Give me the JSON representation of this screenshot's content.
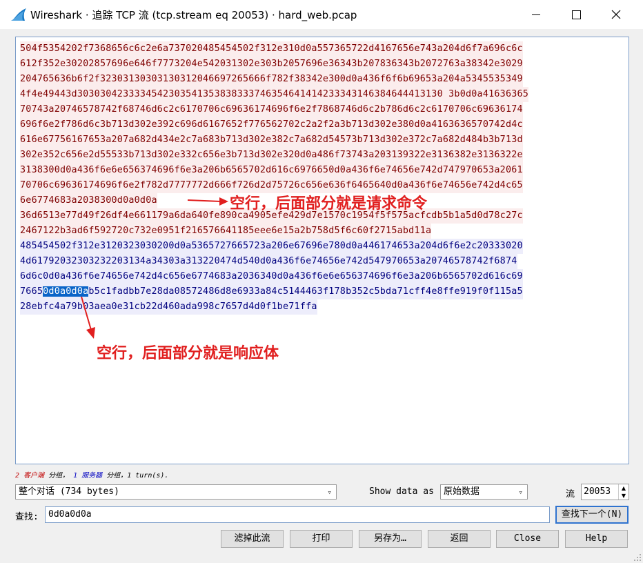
{
  "window": {
    "title": "Wireshark · 追踪 TCP 流 (tcp.stream eq 20053) · hard_web.pcap"
  },
  "stream": {
    "request_lines": [
      "504f5354202f7368656c6c2e6a737020485454502f312e310d0a557365722d4167656e743a204d6f7a696c6c",
      "612f352e30202857696e646f7773204e542031302e303b2057696e36343b207836343b2072763a38342e3029",
      "204765636b6f2f32303130303130312046697265666f782f38342e300d0a436f6f6b69653a204a5345535349",
      "4f4e49443d3030304233334542303541353838333746354641414233343146384644413130 3b0d0a41636365",
      "70743a20746578742f68746d6c2c6170706c69636174696f6e2f7868746d6c2b786d6c2c6170706c69636174",
      "696f6e2f786d6c3b713d302e392c696d6167652f776562702c2a2f2a3b713d302e380d0a4163636570742d4c",
      "616e67756167653a207a682d434e2c7a683b713d302e382c7a682d54573b713d302e372c7a682d484b3b713d",
      "302e352c656e2d55533b713d302e332c656e3b713d302e320d0a486f73743a203139322e3136382e3136322e",
      "3138300d0a436f6e6e656374696f6e3a206b6565702d616c6976650d0a436f6e74656e742d747970653a2061",
      "70706c69636174696f6e2f782d7777772d666f726d2d75726c656e636f6465640d0a436f6e74656e742d4c65",
      "6e6774683a2038300d0a0d0a",
      "36d6513e77d49f26df4e661179a6da640fe890ca4905efe429d7e1570c1954f5f575acfcdb5b1a5d0d78c27c",
      "2467122b3ad6f592720c732e0951f216576641185eee6e15a2b758d5f6c60f2715abd11a"
    ],
    "response_lines": [
      "485454502f312e3120323030200d0a5365727665723a206e67696e780d0a446174653a204d6f6e2c20333020",
      "4d61792032303232203134a34303a313220474d540d0a436f6e74656e742d547970653a20746578742f6874",
      "6d6c0d0a436f6e74656e742d4c656e6774683a2036340d0a436f6e6e656374696f6e3a206b6565702d616c69",
      "7665",
      "0d0a0d0a",
      "b5c1fadbb7e28da08572486d8e6933a84c5144463f178b352c5bda71cff4e8ffe919f0f115a5",
      "28ebfc4a79b03aea0e31cb22d460ada998c7657d4d0f1be71ffa"
    ]
  },
  "annotations": {
    "request_note": "空行，后面部分就是请求命令",
    "response_note": "空行，后面部分就是响应体"
  },
  "stats": {
    "clients_count": "2",
    "clients_label": "客户端",
    "part1": "分组，",
    "servers_count": "1",
    "servers_label": "服务器",
    "part2": "分组，1 turn(s)."
  },
  "controls": {
    "conversation_select": "整个对话 (734 bytes)",
    "show_data_as_label": "Show data as",
    "show_data_as_value": "原始数据",
    "stream_label": "流",
    "stream_value": "20053",
    "find_label": "查找:",
    "find_value": "0d0a0d0a",
    "find_next_button": "查找下一个(N)"
  },
  "buttons": {
    "filter_out": "滤掉此流",
    "print": "打印",
    "save_as": "另存为…",
    "back": "返回",
    "close": "Close",
    "help": "Help"
  },
  "colors": {
    "request_bg": "#fbeded",
    "request_fg": "#7f0000",
    "response_bg": "#ededfb",
    "response_fg": "#00007f",
    "annotation": "#e11f1f",
    "selection": "#0a64c8"
  }
}
